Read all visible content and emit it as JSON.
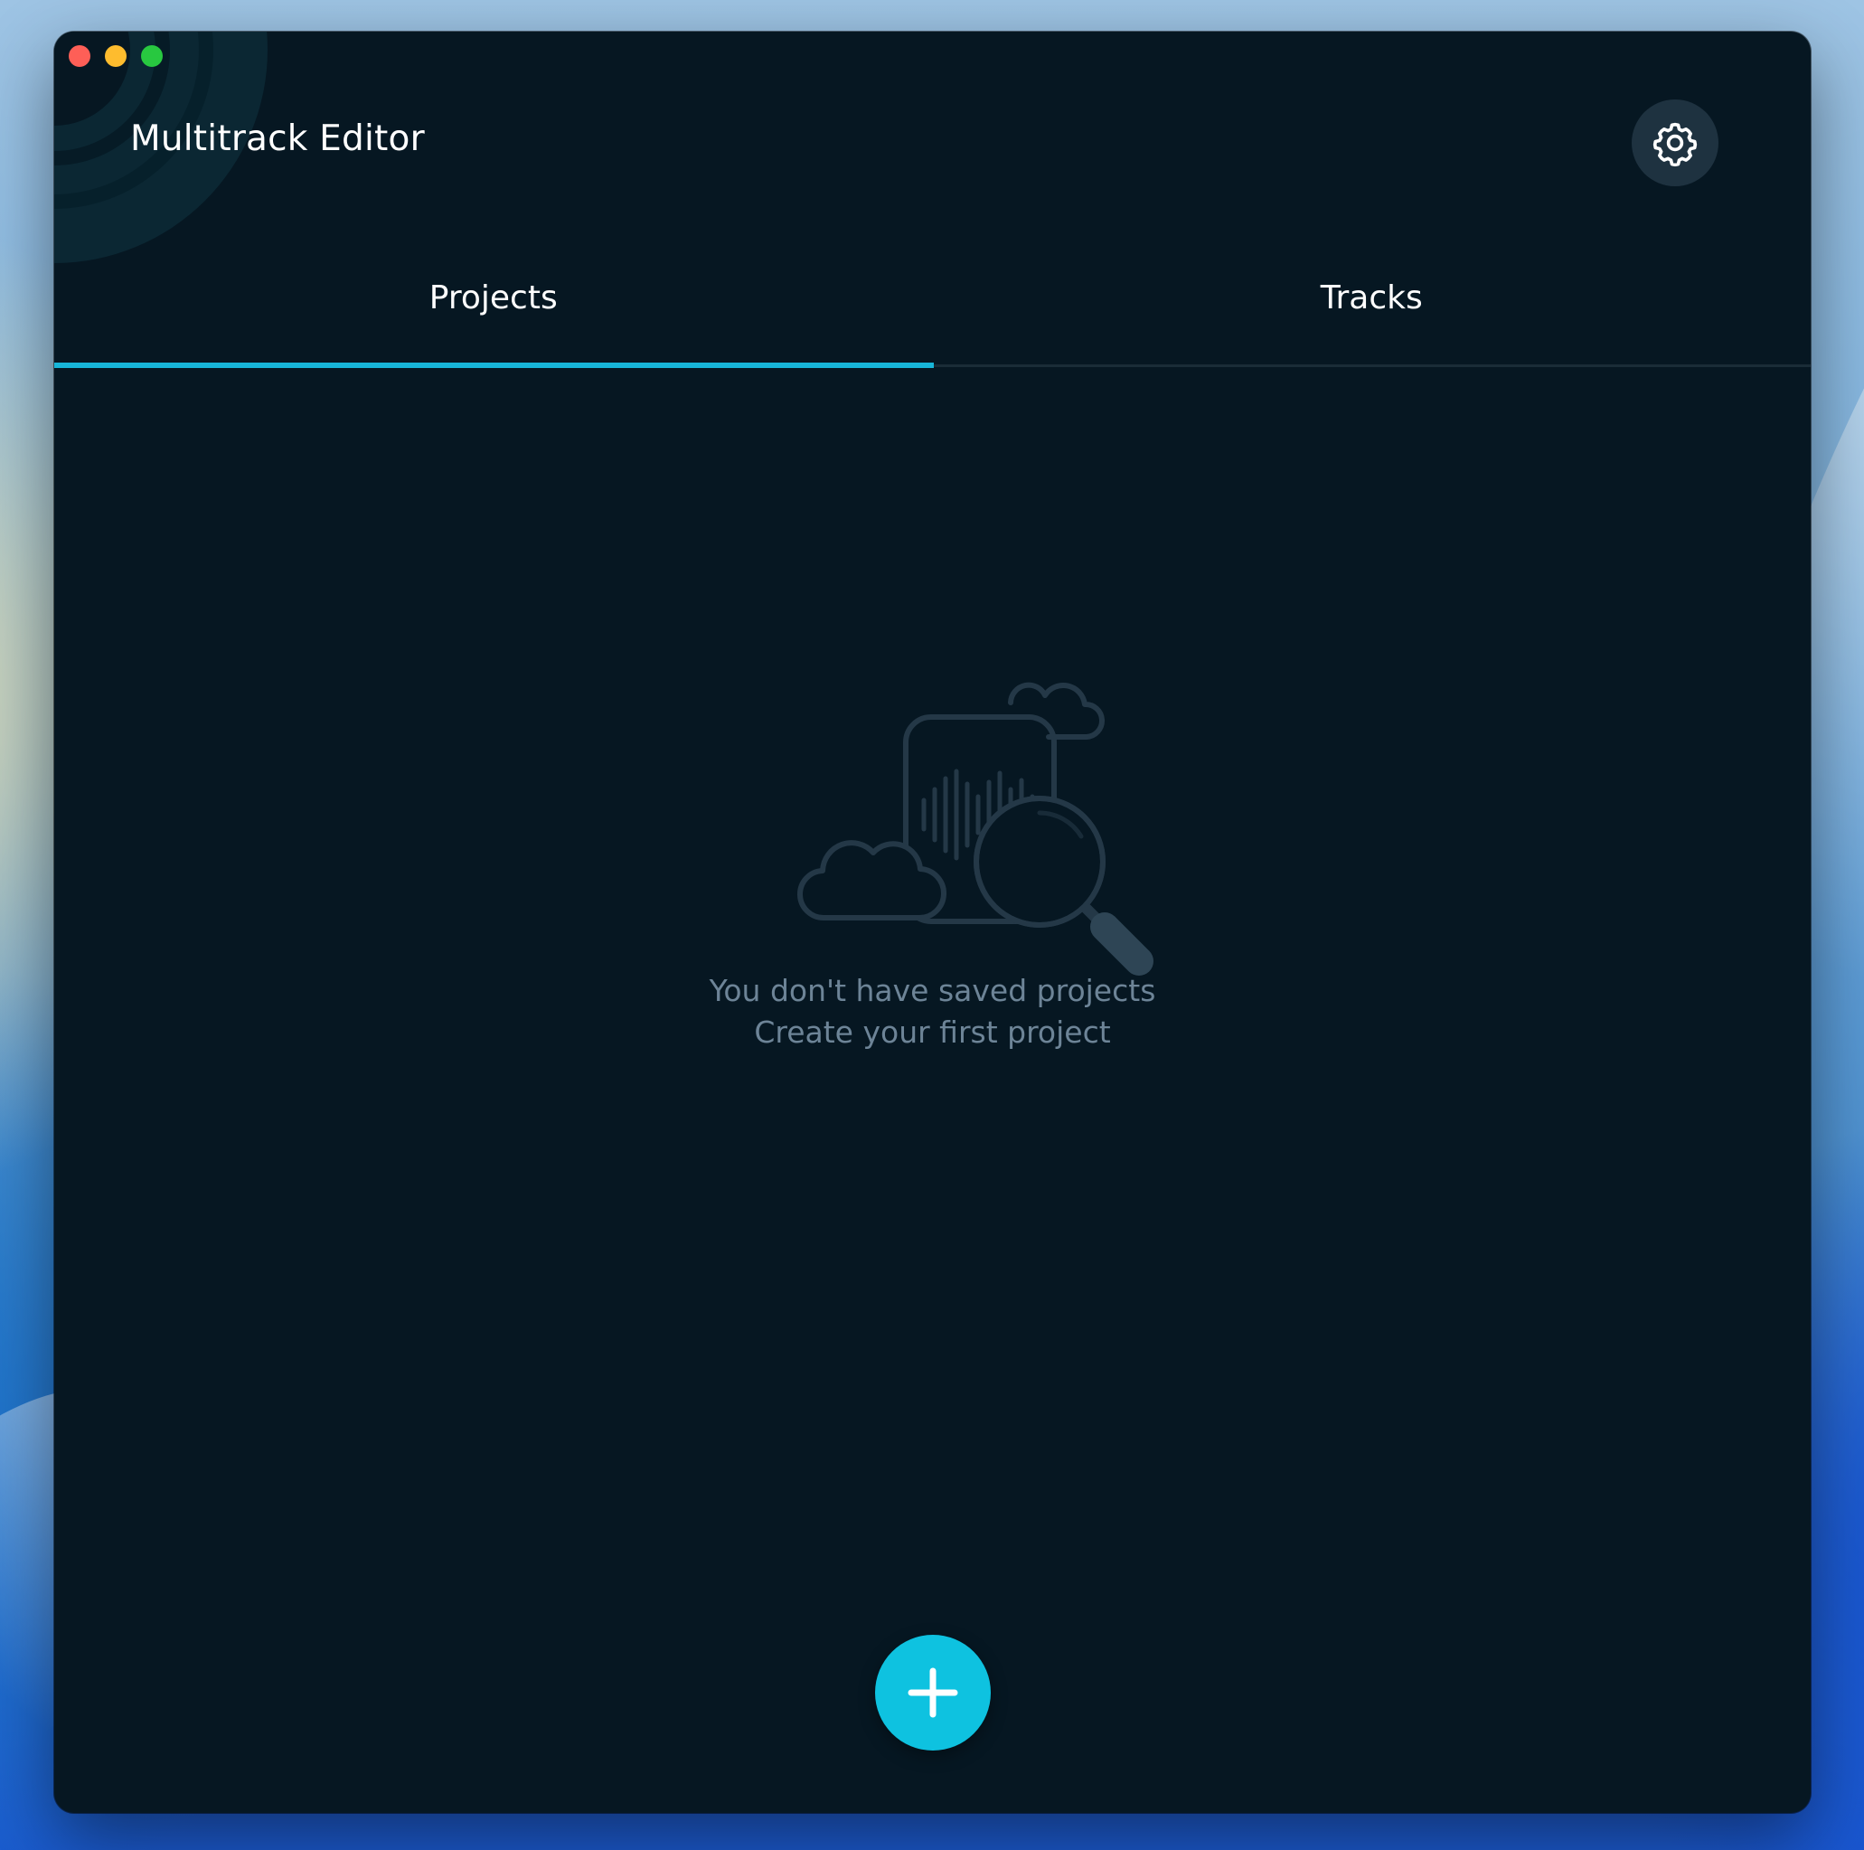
{
  "app": {
    "title": "Multitrack Editor"
  },
  "tabs": [
    {
      "label": "Projects",
      "active": true
    },
    {
      "label": "Tracks",
      "active": false
    }
  ],
  "empty_state": {
    "line1": "You don't have saved projects",
    "line2": "Create your first project"
  },
  "icons": {
    "settings": "gear-icon",
    "add": "plus-icon",
    "illustration": "audio-file-search-illustration"
  },
  "colors": {
    "window_bg": "#061722",
    "accent": "#17b6d9",
    "fab": "#0ec2e0",
    "muted_text": "#6d8497",
    "illustration": "#243847"
  }
}
